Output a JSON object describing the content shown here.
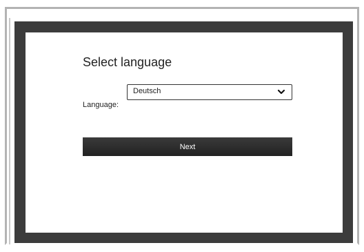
{
  "dialog": {
    "title": "Select language",
    "language_label": "Language:",
    "language_selected": "Deutsch",
    "next_label": "Next"
  },
  "icons": {
    "dropdown": "chevron-down-icon"
  },
  "colors": {
    "window_frame": "#3c3c3c",
    "button_background": "#2a2a2a",
    "button_text": "#ffffff"
  }
}
